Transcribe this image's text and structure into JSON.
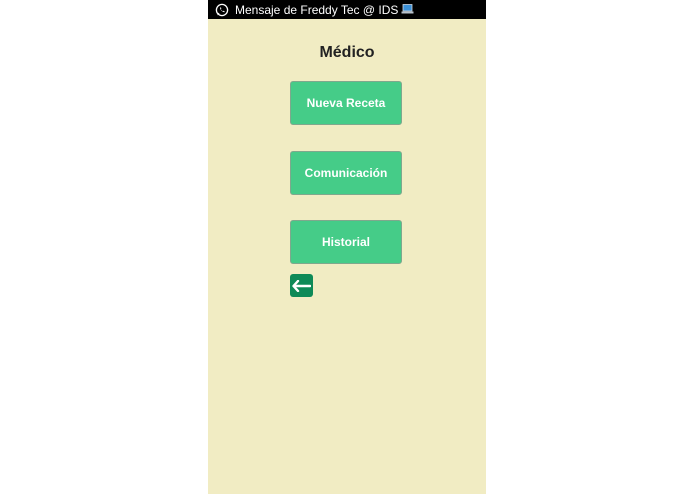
{
  "notification": {
    "text": "Mensaje de Freddy Tec @ IDS",
    "app_icon": "whatsapp-icon",
    "trailing_icon": "laptop-icon"
  },
  "page": {
    "title": "Médico"
  },
  "buttons": {
    "new_prescription": "Nueva Receta",
    "communication": "Comunicación",
    "history": "Historial"
  },
  "back": {
    "icon": "arrow-left-icon"
  },
  "colors": {
    "background": "#f1ecc3",
    "button": "#45cc88",
    "back_button": "#0e8a57",
    "status_bar": "#000000"
  }
}
